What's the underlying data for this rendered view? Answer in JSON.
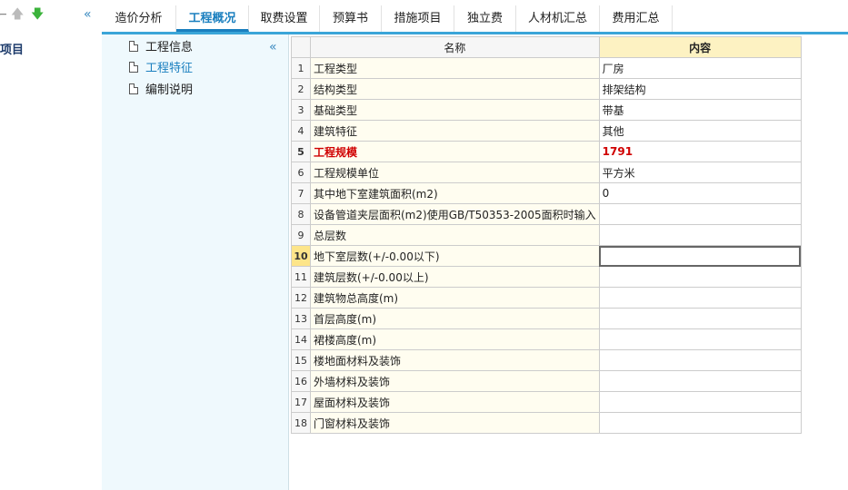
{
  "left_panel": {
    "project_label": "项目",
    "icons": [
      "arrow-left-icon",
      "arrow-up-icon",
      "arrow-down-icon",
      "double-chevron-left-icon"
    ]
  },
  "tabs": [
    {
      "label": "造价分析"
    },
    {
      "label": "工程概况"
    },
    {
      "label": "取费设置"
    },
    {
      "label": "预算书"
    },
    {
      "label": "措施项目"
    },
    {
      "label": "独立费"
    },
    {
      "label": "人材机汇总"
    },
    {
      "label": "费用汇总"
    }
  ],
  "active_tab": 1,
  "tree": {
    "items": [
      {
        "label": "工程信息"
      },
      {
        "label": "工程特征"
      },
      {
        "label": "编制说明"
      }
    ],
    "selected": 1
  },
  "grid": {
    "headers": {
      "name": "名称",
      "content": "内容"
    },
    "rows": [
      {
        "num": "1",
        "name": "工程类型",
        "content": "厂房"
      },
      {
        "num": "2",
        "name": "结构类型",
        "content": "排架结构"
      },
      {
        "num": "3",
        "name": "基础类型",
        "content": "带基"
      },
      {
        "num": "4",
        "name": "建筑特征",
        "content": "其他"
      },
      {
        "num": "5",
        "name": "工程规模",
        "content": "1791"
      },
      {
        "num": "6",
        "name": "工程规模单位",
        "content": "平方米"
      },
      {
        "num": "7",
        "name": "其中地下室建筑面积(m2)",
        "content": "0"
      },
      {
        "num": "8",
        "name": "设备管道夹层面积(m2)使用GB/T50353-2005面积时输入",
        "content": ""
      },
      {
        "num": "9",
        "name": "总层数",
        "content": ""
      },
      {
        "num": "10",
        "name": "地下室层数(+/-0.00以下)",
        "content": ""
      },
      {
        "num": "11",
        "name": "建筑层数(+/-0.00以上)",
        "content": ""
      },
      {
        "num": "12",
        "name": "建筑物总高度(m)",
        "content": ""
      },
      {
        "num": "13",
        "name": "首层高度(m)",
        "content": ""
      },
      {
        "num": "14",
        "name": "裙楼高度(m)",
        "content": ""
      },
      {
        "num": "15",
        "name": "楼地面材料及装饰",
        "content": ""
      },
      {
        "num": "16",
        "name": "外墙材料及装饰",
        "content": ""
      },
      {
        "num": "17",
        "name": "屋面材料及装饰",
        "content": ""
      },
      {
        "num": "18",
        "name": "门窗材料及装饰",
        "content": ""
      }
    ],
    "highlight_row": 4,
    "current_row": 9
  },
  "colors": {
    "accent": "#1a7fbf",
    "tabbar_border": "#3aa5d8",
    "highlight_text": "#d00000",
    "content_header_bg": "#fdf2c2",
    "tree_bg": "#eff9fd"
  }
}
